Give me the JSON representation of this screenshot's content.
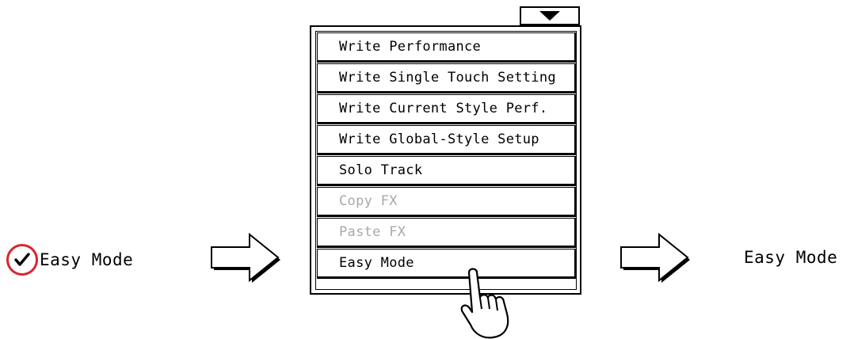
{
  "before": {
    "check_icon": "checkmark-icon",
    "label": "Easy Mode",
    "highlight_color": "#d8262c"
  },
  "flow_arrow_icon": "right-arrow-icon",
  "dropdown": {
    "icon": "triangle-down-icon"
  },
  "menu": {
    "items": [
      {
        "label": "Write Performance",
        "enabled": true
      },
      {
        "label": "Write Single Touch Setting",
        "enabled": true
      },
      {
        "label": "Write Current Style Perf.",
        "enabled": true
      },
      {
        "label": "Write Global-Style Setup",
        "enabled": true
      },
      {
        "label": "Solo Track",
        "enabled": true
      },
      {
        "label": "Copy FX",
        "enabled": false
      },
      {
        "label": "Paste FX",
        "enabled": false
      },
      {
        "label": "Easy Mode",
        "enabled": true
      }
    ]
  },
  "cursor_icon": "pointing-hand-icon",
  "after": {
    "label": "Easy Mode"
  }
}
